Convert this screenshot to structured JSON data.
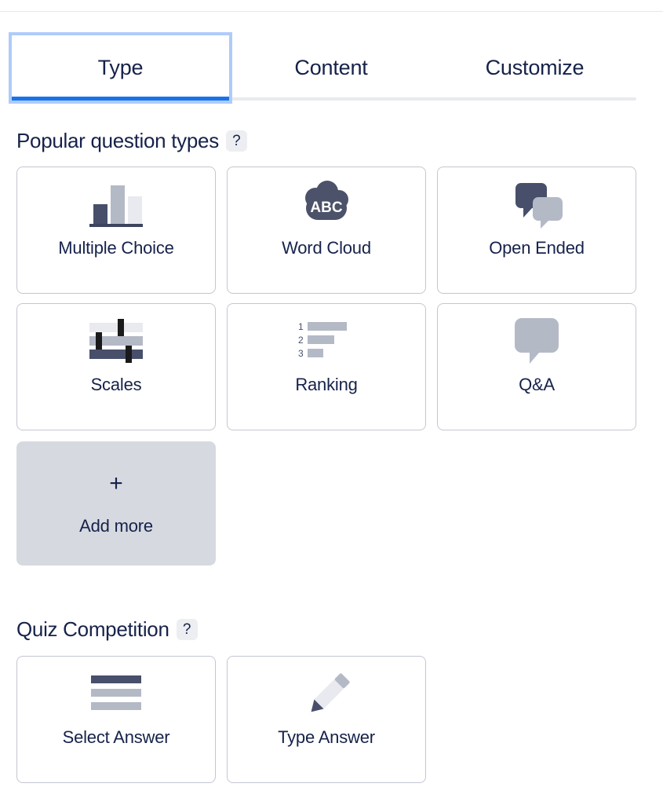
{
  "tabs": [
    {
      "label": "Type",
      "active": true
    },
    {
      "label": "Content",
      "active": false
    },
    {
      "label": "Customize",
      "active": false
    }
  ],
  "sections": [
    {
      "title": "Popular question types",
      "help": "?",
      "cards": [
        {
          "label": "Multiple Choice",
          "icon": "bar-chart-icon"
        },
        {
          "label": "Word Cloud",
          "icon": "cloud-abc-icon"
        },
        {
          "label": "Open Ended",
          "icon": "two-speech-bubbles-icon"
        },
        {
          "label": "Scales",
          "icon": "sliders-icon"
        },
        {
          "label": "Ranking",
          "icon": "ranked-bars-icon"
        },
        {
          "label": "Q&A",
          "icon": "speech-bubble-icon"
        }
      ],
      "add_more": {
        "label": "Add more",
        "glyph": "+"
      }
    },
    {
      "title": "Quiz Competition",
      "help": "?",
      "cards": [
        {
          "label": "Select Answer",
          "icon": "list-lines-icon"
        },
        {
          "label": "Type Answer",
          "icon": "pencil-icon"
        }
      ]
    }
  ],
  "ranking_numbers": [
    "1",
    "2",
    "3"
  ],
  "word_cloud_text": "ABC",
  "colors": {
    "accent_blue": "#1a73e8",
    "focus_ring": "#aecbfa",
    "ink": "#16224a",
    "icon_dark": "#474f6b",
    "icon_mid": "#b4b9c6",
    "icon_light": "#e8eaef",
    "card_border": "#c3c7d1",
    "add_more_bg": "#d6d9e0"
  }
}
